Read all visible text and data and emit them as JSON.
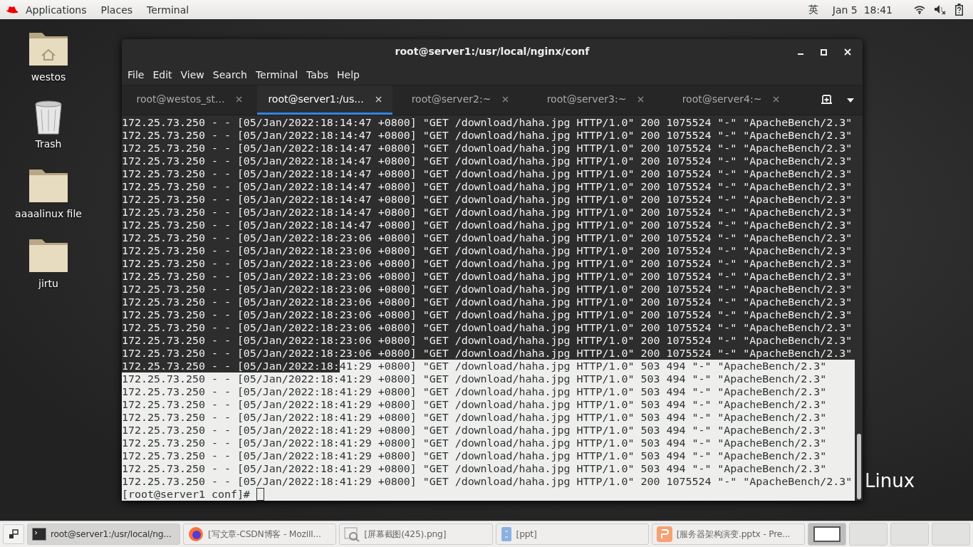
{
  "top_bar": {
    "menus": [
      "Applications",
      "Places",
      "Terminal"
    ],
    "input_method": "英",
    "clock": "Jan 5  18:41"
  },
  "desktop_icons": [
    {
      "kind": "home",
      "label": "westos"
    },
    {
      "kind": "trash",
      "label": "Trash"
    },
    {
      "kind": "folder",
      "label": "aaaalinux file"
    },
    {
      "kind": "folder",
      "label": "jirtu"
    }
  ],
  "wallpaper_text": "Linux",
  "terminal_window": {
    "title": "root@server1:/usr/local/nginx/conf",
    "menu": [
      "File",
      "Edit",
      "View",
      "Search",
      "Terminal",
      "Tabs",
      "Help"
    ],
    "tabs": [
      {
        "label": "root@westos_st...",
        "selected": false
      },
      {
        "label": "root@server1:/us...",
        "selected": true
      },
      {
        "label": "root@server2:~",
        "selected": false
      },
      {
        "label": "root@server3:~",
        "selected": false
      },
      {
        "label": "root@server4:~",
        "selected": false
      }
    ],
    "lines": [
      [
        {
          "text": "172.25.73.250 - - [05/Jan/2022:18:14:47 +0800] \"GET /download/haha.jpg HTTP/1.0\" 200 1075524 \"-\" \"ApacheBench/2.3\"",
          "selected": false
        }
      ],
      [
        {
          "text": "172.25.73.250 - - [05/Jan/2022:18:14:47 +0800] \"GET /download/haha.jpg HTTP/1.0\" 200 1075524 \"-\" \"ApacheBench/2.3\"",
          "selected": false
        }
      ],
      [
        {
          "text": "172.25.73.250 - - [05/Jan/2022:18:14:47 +0800] \"GET /download/haha.jpg HTTP/1.0\" 200 1075524 \"-\" \"ApacheBench/2.3\"",
          "selected": false
        }
      ],
      [
        {
          "text": "172.25.73.250 - - [05/Jan/2022:18:14:47 +0800] \"GET /download/haha.jpg HTTP/1.0\" 200 1075524 \"-\" \"ApacheBench/2.3\"",
          "selected": false
        }
      ],
      [
        {
          "text": "172.25.73.250 - - [05/Jan/2022:18:14:47 +0800] \"GET /download/haha.jpg HTTP/1.0\" 200 1075524 \"-\" \"ApacheBench/2.3\"",
          "selected": false
        }
      ],
      [
        {
          "text": "172.25.73.250 - - [05/Jan/2022:18:14:47 +0800] \"GET /download/haha.jpg HTTP/1.0\" 200 1075524 \"-\" \"ApacheBench/2.3\"",
          "selected": false
        }
      ],
      [
        {
          "text": "172.25.73.250 - - [05/Jan/2022:18:14:47 +0800] \"GET /download/haha.jpg HTTP/1.0\" 200 1075524 \"-\" \"ApacheBench/2.3\"",
          "selected": false
        }
      ],
      [
        {
          "text": "172.25.73.250 - - [05/Jan/2022:18:14:47 +0800] \"GET /download/haha.jpg HTTP/1.0\" 200 1075524 \"-\" \"ApacheBench/2.3\"",
          "selected": false
        }
      ],
      [
        {
          "text": "172.25.73.250 - - [05/Jan/2022:18:14:47 +0800] \"GET /download/haha.jpg HTTP/1.0\" 200 1075524 \"-\" \"ApacheBench/2.3\"",
          "selected": false
        }
      ],
      [
        {
          "text": "172.25.73.250 - - [05/Jan/2022:18:23:06 +0800] \"GET /download/haha.jpg HTTP/1.0\" 200 1075524 \"-\" \"ApacheBench/2.3\"",
          "selected": false
        }
      ],
      [
        {
          "text": "172.25.73.250 - - [05/Jan/2022:18:23:06 +0800] \"GET /download/haha.jpg HTTP/1.0\" 200 1075524 \"-\" \"ApacheBench/2.3\"",
          "selected": false
        }
      ],
      [
        {
          "text": "172.25.73.250 - - [05/Jan/2022:18:23:06 +0800] \"GET /download/haha.jpg HTTP/1.0\" 200 1075524 \"-\" \"ApacheBench/2.3\"",
          "selected": false
        }
      ],
      [
        {
          "text": "172.25.73.250 - - [05/Jan/2022:18:23:06 +0800] \"GET /download/haha.jpg HTTP/1.0\" 200 1075524 \"-\" \"ApacheBench/2.3\"",
          "selected": false
        }
      ],
      [
        {
          "text": "172.25.73.250 - - [05/Jan/2022:18:23:06 +0800] \"GET /download/haha.jpg HTTP/1.0\" 200 1075524 \"-\" \"ApacheBench/2.3\"",
          "selected": false
        }
      ],
      [
        {
          "text": "172.25.73.250 - - [05/Jan/2022:18:23:06 +0800] \"GET /download/haha.jpg HTTP/1.0\" 200 1075524 \"-\" \"ApacheBench/2.3\"",
          "selected": false
        }
      ],
      [
        {
          "text": "172.25.73.250 - - [05/Jan/2022:18:23:06 +0800] \"GET /download/haha.jpg HTTP/1.0\" 200 1075524 \"-\" \"ApacheBench/2.3\"",
          "selected": false
        }
      ],
      [
        {
          "text": "172.25.73.250 - - [05/Jan/2022:18:23:06 +0800] \"GET /download/haha.jpg HTTP/1.0\" 200 1075524 \"-\" \"ApacheBench/2.3\"",
          "selected": false
        }
      ],
      [
        {
          "text": "172.25.73.250 - - [05/Jan/2022:18:23:06 +0800] \"GET /download/haha.jpg HTTP/1.0\" 200 1075524 \"-\" \"ApacheBench/2.3\"",
          "selected": false
        }
      ],
      [
        {
          "text": "172.25.73.250 - - [05/Jan/2022:18:23:06 +0800] \"GET /download/haha.jpg HTTP/1.0\" 200 1075524 \"-\" \"ApacheBench/2.3\"",
          "selected": false
        }
      ],
      [
        {
          "text": "172.25.73.250 - - [05/Jan/2022:18:",
          "selected": false
        },
        {
          "text": "41:29 +0800] \"GET /download/haha.jpg HTTP/1.0\" 503 494 \"-\" \"ApacheBench/2.3\"",
          "selected": true
        }
      ],
      [
        {
          "text": "172.25.73.250 - - [05/Jan/2022:18:41:29 +0800] \"GET /download/haha.jpg HTTP/1.0\" 503 494 \"-\" \"ApacheBench/2.3\"",
          "selected": true
        }
      ],
      [
        {
          "text": "172.25.73.250 - - [05/Jan/2022:18:41:29 +0800] \"GET /download/haha.jpg HTTP/1.0\" 503 494 \"-\" \"ApacheBench/2.3\"",
          "selected": true
        }
      ],
      [
        {
          "text": "172.25.73.250 - - [05/Jan/2022:18:41:29 +0800] \"GET /download/haha.jpg HTTP/1.0\" 503 494 \"-\" \"ApacheBench/2.3\"",
          "selected": true
        }
      ],
      [
        {
          "text": "172.25.73.250 - - [05/Jan/2022:18:41:29 +0800] \"GET /download/haha.jpg HTTP/1.0\" 503 494 \"-\" \"ApacheBench/2.3\"",
          "selected": true
        }
      ],
      [
        {
          "text": "172.25.73.250 - - [05/Jan/2022:18:41:29 +0800] \"GET /download/haha.jpg HTTP/1.0\" 503 494 \"-\" \"ApacheBench/2.3\"",
          "selected": true
        }
      ],
      [
        {
          "text": "172.25.73.250 - - [05/Jan/2022:18:41:29 +0800] \"GET /download/haha.jpg HTTP/1.0\" 503 494 \"-\" \"ApacheBench/2.3\"",
          "selected": true
        }
      ],
      [
        {
          "text": "172.25.73.250 - - [05/Jan/2022:18:41:29 +0800] \"GET /download/haha.jpg HTTP/1.0\" 503 494 \"-\" \"ApacheBench/2.3\"",
          "selected": true
        }
      ],
      [
        {
          "text": "172.25.73.250 - - [05/Jan/2022:18:41:29 +0800] \"GET /download/haha.jpg HTTP/1.0\" 503 494 \"-\" \"ApacheBench/2.3\"",
          "selected": true
        }
      ],
      [
        {
          "text": "172.25.73.250 - - [05/Jan/2022:18:41:29 +0800] \"GET /download/haha.jpg HTTP/1.0\" 200 1075524 \"-\" \"ApacheBench/2.3\"",
          "selected": true
        }
      ],
      [
        {
          "text": "[root@server1 conf]# ",
          "selected": true
        }
      ]
    ]
  },
  "taskbar": {
    "windows": [
      {
        "kind": "terminal",
        "label": "root@server1:/usr/local/ng...",
        "selected": true
      },
      {
        "kind": "browser",
        "label": "[写文章-CSDN博客 - Mozill...",
        "selected": false
      },
      {
        "kind": "image",
        "label": "[屏幕截图(425).png]",
        "selected": false
      },
      {
        "kind": "files",
        "label": "[ppt]",
        "selected": false
      },
      {
        "kind": "slides",
        "label": "[服务器架构演变.pptx - Pre...",
        "selected": false
      }
    ],
    "workspaces": [
      {
        "selected": true
      },
      {
        "selected": false
      },
      {
        "selected": false
      },
      {
        "selected": false
      }
    ]
  }
}
